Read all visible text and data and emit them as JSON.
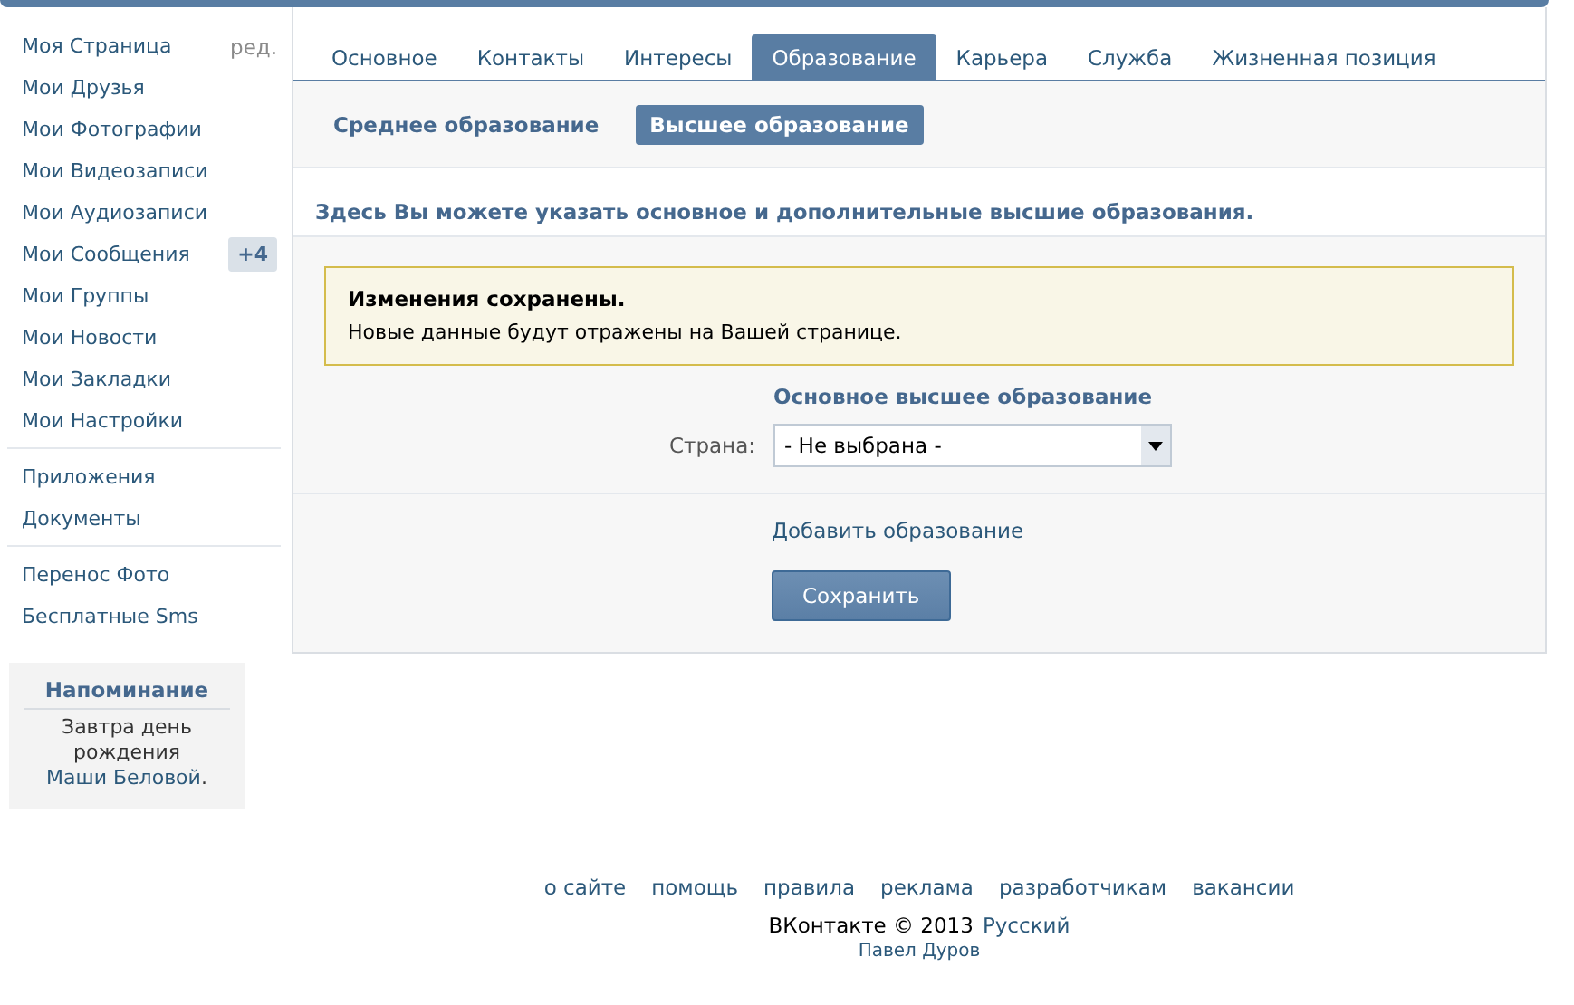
{
  "sidebar": {
    "items": [
      {
        "label": "Моя Страница",
        "extra": "ред."
      },
      {
        "label": "Мои Друзья"
      },
      {
        "label": "Мои Фотографии"
      },
      {
        "label": "Мои Видеозаписи"
      },
      {
        "label": "Мои Аудиозаписи"
      },
      {
        "label": "Мои Сообщения",
        "badge": "+4"
      },
      {
        "label": "Мои Группы"
      },
      {
        "label": "Мои Новости"
      },
      {
        "label": "Мои Закладки"
      },
      {
        "label": "Мои Настройки",
        "divider_after": true
      },
      {
        "label": "Приложения"
      },
      {
        "label": "Документы",
        "divider_after": true
      },
      {
        "label": "Перенос Фото"
      },
      {
        "label": "Бесплатные Sms"
      }
    ],
    "reminder": {
      "title": "Напоминание",
      "text": "Завтра день рождения",
      "link": "Маши Беловой",
      "after": "."
    }
  },
  "tabs": [
    {
      "label": "Основное",
      "selected": false
    },
    {
      "label": "Контакты",
      "selected": false
    },
    {
      "label": "Интересы",
      "selected": false
    },
    {
      "label": "Образование",
      "selected": true
    },
    {
      "label": "Карьера",
      "selected": false
    },
    {
      "label": "Служба",
      "selected": false
    },
    {
      "label": "Жизненная позиция",
      "selected": false
    }
  ],
  "subtabs": [
    {
      "label": "Среднее образование",
      "selected": false
    },
    {
      "label": "Высшее образование",
      "selected": true
    }
  ],
  "intro": "Здесь Вы можете указать основное и дополнительные высшие образования.",
  "notice": {
    "title": "Изменения сохранены.",
    "text": "Новые данные будут отражены на Вашей странице."
  },
  "form": {
    "section_title": "Основное высшее образование",
    "country_label": "Страна:",
    "country_value": "- Не выбрана -",
    "add_link": "Добавить образование",
    "save_button": "Сохранить"
  },
  "footer": {
    "links": [
      "о сайте",
      "помощь",
      "правила",
      "реклама",
      "разработчикам",
      "вакансии"
    ],
    "copyright": "ВКонтакте © 2013",
    "language": "Русский",
    "author": "Павел Дуров"
  }
}
